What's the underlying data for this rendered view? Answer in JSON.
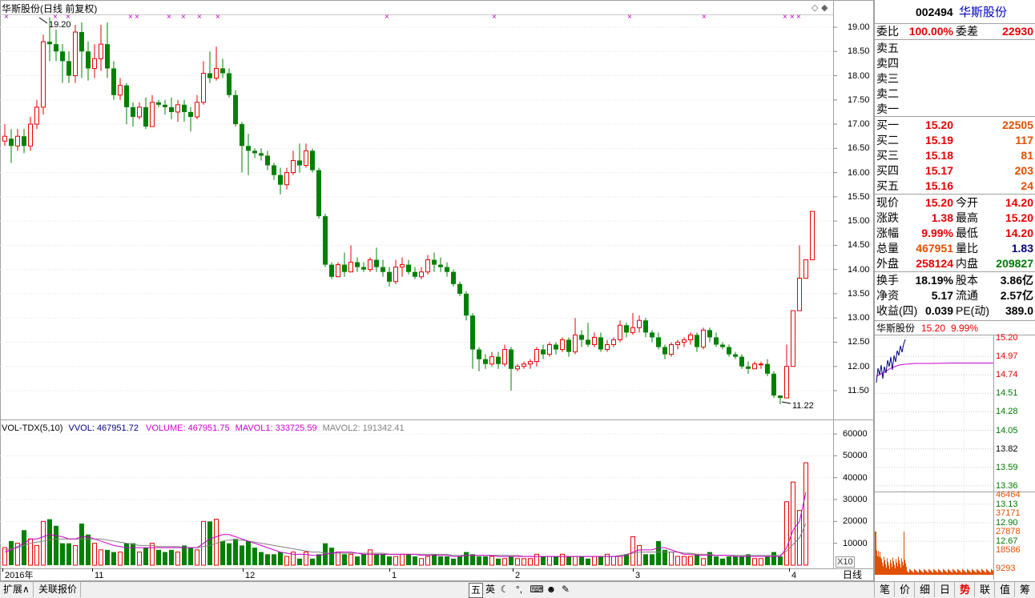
{
  "stock": {
    "code": "002494",
    "name": "华斯股份"
  },
  "chart_title": "华斯股份(日线 前复权)",
  "chart_type_label": "日线",
  "price_axis": [
    "19.00",
    "18.50",
    "18.00",
    "17.50",
    "17.00",
    "16.50",
    "16.00",
    "15.50",
    "15.00",
    "14.50",
    "14.00",
    "13.50",
    "13.00",
    "12.50",
    "12.00",
    "11.50"
  ],
  "volume_axis": [
    "60000",
    "50000",
    "40000",
    "30000",
    "20000",
    "10000"
  ],
  "volume_unit": "X10",
  "date_labels": [
    "2016年",
    "11",
    "12",
    "1",
    "2",
    "3",
    "4"
  ],
  "max_marker": "19.20",
  "min_marker": "11.22",
  "indicator": {
    "name": "VOL-TDX(5,10)",
    "vvol": "VVOL: 467951.72",
    "volume": "VOLUME: 467951.75",
    "mavol1": "MAVOL1: 333725.59",
    "mavol2": "MAVOL2: 191342.41"
  },
  "orderbook": {
    "weibi_label": "委比",
    "weibi_value": "100.00%",
    "weicha_label": "委差",
    "weicha_value": "22930",
    "sells": [
      {
        "label": "卖五"
      },
      {
        "label": "卖四"
      },
      {
        "label": "卖三"
      },
      {
        "label": "卖二"
      },
      {
        "label": "卖一"
      }
    ],
    "buys": [
      {
        "label": "买一",
        "price": "15.20",
        "vol": "22505"
      },
      {
        "label": "买二",
        "price": "15.19",
        "vol": "117"
      },
      {
        "label": "买三",
        "price": "15.18",
        "vol": "81"
      },
      {
        "label": "买四",
        "price": "15.17",
        "vol": "203"
      },
      {
        "label": "买五",
        "price": "15.16",
        "vol": "24"
      }
    ]
  },
  "quote": [
    {
      "l1": "现价",
      "v1": "15.20",
      "l2": "今开",
      "v2": "14.20"
    },
    {
      "l1": "涨跌",
      "v1": "1.38",
      "l2": "最高",
      "v2": "15.20"
    },
    {
      "l1": "涨幅",
      "v1": "9.99%",
      "l2": "最低",
      "v2": "14.20"
    },
    {
      "l1": "总量",
      "v1": "467951",
      "l2": "量比",
      "v2": "1.83"
    },
    {
      "l1": "外盘",
      "v1": "258124",
      "l2": "内盘",
      "v2": "209827"
    }
  ],
  "fundamentals": [
    {
      "l1": "换手",
      "v1": "18.19%",
      "l2": "股本",
      "v2": "3.86亿"
    },
    {
      "l1": "净资",
      "v1": "5.17",
      "l2": "流通",
      "v2": "2.57亿"
    },
    {
      "l1": "收益(四)",
      "v1": "0.039",
      "l2": "PE(动)",
      "v2": "389.0"
    }
  ],
  "mini_chart": {
    "name": "华斯股份",
    "price": "15.20",
    "pct": "9.99%",
    "price_axis": [
      "15.20",
      "14.97",
      "14.74",
      "14.51",
      "14.28",
      "14.05",
      "13.82",
      "13.59",
      "13.36",
      "13.13",
      "12.90",
      "12.67"
    ],
    "vol_axis": [
      "46464",
      "37171",
      "27878",
      "18586",
      "9293"
    ]
  },
  "bottom_buttons": [
    "扩展∧",
    "关联报价"
  ],
  "ime_items": [
    "五",
    "英"
  ],
  "right_tabs": [
    "笔",
    "价",
    "细",
    "日",
    "势",
    "联",
    "值",
    "筹"
  ],
  "active_right_tab": "势",
  "colors": {
    "up": "#e60000",
    "down": "#008000",
    "grid": "#e0e0e0",
    "axis_text": "#000000",
    "ma1": "#cc00cc",
    "ma2": "#808080"
  },
  "chart_data": {
    "type": "candlestick",
    "title": "华斯股份(日线 前复权)",
    "price_ylim": [
      11.0,
      19.3
    ],
    "candles": [
      [
        16.65,
        16.75,
        16.55,
        17.0
      ],
      [
        16.7,
        16.55,
        16.2,
        16.9
      ],
      [
        16.55,
        16.75,
        16.45,
        16.9
      ],
      [
        16.75,
        16.55,
        16.4,
        16.9
      ],
      [
        16.55,
        17.0,
        16.45,
        17.15
      ],
      [
        17.0,
        17.35,
        16.9,
        17.5
      ],
      [
        17.35,
        18.7,
        17.2,
        18.85
      ],
      [
        18.7,
        18.65,
        18.3,
        19.2
      ],
      [
        18.65,
        18.5,
        18.3,
        18.95
      ],
      [
        18.5,
        18.3,
        17.85,
        18.65
      ],
      [
        18.3,
        18.0,
        17.85,
        18.5
      ],
      [
        18.0,
        18.9,
        17.85,
        19.05
      ],
      [
        18.9,
        18.5,
        17.95,
        19.1
      ],
      [
        18.5,
        18.15,
        17.9,
        18.7
      ],
      [
        18.15,
        18.35,
        17.95,
        18.65
      ],
      [
        18.35,
        18.65,
        18.1,
        19.05
      ],
      [
        18.65,
        18.15,
        17.95,
        19.1
      ],
      [
        18.15,
        17.6,
        17.5,
        18.3
      ],
      [
        17.6,
        17.8,
        17.5,
        17.95
      ],
      [
        17.8,
        17.35,
        17.0,
        17.85
      ],
      [
        17.35,
        17.15,
        16.95,
        17.45
      ],
      [
        17.15,
        17.35,
        17.1,
        17.45
      ],
      [
        17.35,
        16.95,
        16.9,
        17.55
      ],
      [
        16.95,
        17.45,
        16.95,
        17.6
      ],
      [
        17.45,
        17.4,
        17.35,
        17.5
      ],
      [
        17.4,
        17.35,
        17.2,
        17.5
      ],
      [
        17.35,
        17.25,
        17.1,
        17.55
      ],
      [
        17.25,
        17.4,
        17.05,
        17.5
      ],
      [
        17.4,
        17.25,
        17.05,
        17.5
      ],
      [
        17.25,
        17.15,
        16.85,
        17.35
      ],
      [
        17.15,
        17.45,
        17.1,
        17.6
      ],
      [
        17.45,
        18.05,
        17.4,
        18.3
      ],
      [
        18.05,
        17.95,
        17.85,
        18.5
      ],
      [
        17.95,
        18.15,
        17.9,
        18.6
      ],
      [
        18.15,
        18.05,
        17.95,
        18.35
      ],
      [
        18.05,
        17.6,
        17.55,
        18.15
      ],
      [
        17.6,
        17.0,
        16.95,
        17.7
      ],
      [
        17.0,
        16.55,
        16.0,
        17.05
      ],
      [
        16.55,
        16.45,
        15.95,
        16.8
      ],
      [
        16.45,
        16.4,
        16.3,
        16.5
      ],
      [
        16.4,
        16.35,
        16.25,
        16.5
      ],
      [
        16.35,
        16.15,
        16.05,
        16.45
      ],
      [
        16.15,
        15.95,
        15.85,
        16.2
      ],
      [
        15.95,
        15.75,
        15.55,
        16.1
      ],
      [
        15.75,
        16.0,
        15.65,
        16.1
      ],
      [
        16.0,
        16.25,
        15.95,
        16.45
      ],
      [
        16.25,
        16.15,
        16.0,
        16.6
      ],
      [
        16.15,
        16.45,
        16.1,
        16.6
      ],
      [
        16.45,
        16.05,
        16.0,
        16.5
      ],
      [
        16.05,
        15.1,
        15.05,
        16.1
      ],
      [
        15.1,
        14.1,
        14.05,
        15.15
      ],
      [
        14.1,
        13.85,
        13.8,
        14.15
      ],
      [
        13.85,
        14.1,
        13.85,
        14.15
      ],
      [
        14.1,
        13.95,
        13.85,
        14.35
      ],
      [
        13.95,
        14.15,
        13.95,
        14.5
      ],
      [
        14.15,
        14.05,
        13.95,
        14.25
      ],
      [
        14.05,
        14.0,
        13.95,
        14.15
      ],
      [
        14.0,
        14.2,
        13.95,
        14.25
      ],
      [
        14.2,
        14.05,
        13.95,
        14.45
      ],
      [
        14.05,
        13.95,
        13.85,
        14.2
      ],
      [
        13.95,
        13.75,
        13.65,
        14.05
      ],
      [
        13.75,
        14.05,
        13.7,
        14.2
      ],
      [
        14.05,
        14.1,
        13.85,
        14.25
      ],
      [
        14.1,
        13.95,
        13.9,
        14.2
      ],
      [
        13.95,
        13.85,
        13.8,
        14.05
      ],
      [
        13.85,
        13.95,
        13.8,
        14.05
      ],
      [
        13.95,
        14.2,
        13.9,
        14.3
      ],
      [
        14.2,
        14.1,
        13.95,
        14.35
      ],
      [
        14.1,
        14.05,
        13.95,
        14.25
      ],
      [
        14.05,
        13.95,
        13.85,
        14.15
      ],
      [
        13.95,
        13.7,
        13.65,
        14.0
      ],
      [
        13.7,
        13.5,
        13.45,
        13.75
      ],
      [
        13.5,
        13.05,
        12.95,
        13.55
      ],
      [
        13.05,
        12.35,
        11.95,
        13.1
      ],
      [
        12.35,
        12.15,
        11.9,
        12.4
      ],
      [
        12.15,
        12.05,
        11.95,
        12.25
      ],
      [
        12.05,
        12.2,
        12.0,
        12.3
      ],
      [
        12.2,
        12.05,
        11.95,
        12.3
      ],
      [
        12.05,
        12.35,
        12.0,
        12.45
      ],
      [
        12.35,
        11.95,
        11.5,
        12.4
      ],
      [
        11.95,
        12.0,
        11.9,
        12.05
      ],
      [
        12.0,
        12.05,
        11.95,
        12.1
      ],
      [
        12.05,
        12.1,
        11.95,
        12.15
      ],
      [
        12.1,
        12.35,
        12.0,
        12.4
      ],
      [
        12.35,
        12.25,
        12.15,
        12.45
      ],
      [
        12.25,
        12.45,
        12.2,
        12.5
      ],
      [
        12.45,
        12.35,
        12.25,
        12.5
      ],
      [
        12.35,
        12.55,
        12.3,
        12.6
      ],
      [
        12.55,
        12.3,
        12.2,
        12.6
      ],
      [
        12.3,
        12.65,
        12.25,
        13.0
      ],
      [
        12.65,
        12.55,
        12.4,
        12.75
      ],
      [
        12.55,
        12.45,
        12.4,
        12.9
      ],
      [
        12.45,
        12.6,
        12.4,
        12.7
      ],
      [
        12.6,
        12.35,
        12.3,
        12.7
      ],
      [
        12.35,
        12.45,
        12.3,
        12.55
      ],
      [
        12.45,
        12.55,
        12.4,
        12.6
      ],
      [
        12.55,
        12.85,
        12.5,
        12.95
      ],
      [
        12.85,
        12.7,
        12.6,
        12.9
      ],
      [
        12.7,
        12.8,
        12.65,
        13.1
      ],
      [
        12.8,
        12.95,
        12.7,
        13.05
      ],
      [
        12.95,
        12.7,
        12.6,
        13.0
      ],
      [
        12.7,
        12.6,
        12.5,
        12.75
      ],
      [
        12.6,
        12.4,
        12.35,
        12.7
      ],
      [
        12.4,
        12.25,
        12.15,
        12.45
      ],
      [
        12.25,
        12.45,
        12.2,
        12.5
      ],
      [
        12.45,
        12.5,
        12.35,
        12.55
      ],
      [
        12.5,
        12.55,
        12.4,
        12.6
      ],
      [
        12.55,
        12.65,
        12.45,
        12.7
      ],
      [
        12.65,
        12.4,
        12.3,
        12.7
      ],
      [
        12.4,
        12.75,
        12.35,
        12.8
      ],
      [
        12.75,
        12.6,
        12.5,
        12.8
      ],
      [
        12.6,
        12.45,
        12.4,
        12.7
      ],
      [
        12.45,
        12.4,
        12.35,
        12.5
      ],
      [
        12.4,
        12.25,
        12.2,
        12.45
      ],
      [
        12.25,
        12.2,
        12.15,
        12.3
      ],
      [
        12.2,
        12.0,
        11.95,
        12.25
      ],
      [
        12.0,
        11.95,
        11.85,
        12.1
      ],
      [
        11.95,
        12.05,
        11.95,
        12.1
      ],
      [
        12.05,
        12.05,
        11.95,
        12.1
      ],
      [
        12.05,
        11.85,
        11.8,
        12.15
      ],
      [
        11.85,
        11.4,
        11.35,
        11.9
      ],
      [
        11.4,
        11.35,
        11.22,
        11.4
      ],
      [
        11.35,
        12.0,
        11.35,
        12.45
      ],
      [
        12.0,
        13.15,
        12.8,
        13.15
      ],
      [
        13.15,
        13.82,
        13.6,
        14.5
      ],
      [
        13.82,
        14.2,
        13.82,
        14.2
      ],
      [
        14.2,
        15.2,
        14.2,
        15.2
      ]
    ],
    "volumes": [
      8000,
      11000,
      10000,
      16000,
      12000,
      9000,
      20000,
      21000,
      18000,
      10000,
      10000,
      9000,
      19000,
      14000,
      10000,
      7000,
      7000,
      6000,
      6000,
      10000,
      10000,
      6000,
      8000,
      10000,
      7000,
      6000,
      7000,
      6000,
      9000,
      8000,
      7000,
      20000,
      20000,
      21000,
      11000,
      10000,
      12000,
      9000,
      11000,
      8000,
      6000,
      5000,
      5000,
      6000,
      4000,
      6000,
      3000,
      6000,
      3000,
      5000,
      10000,
      8000,
      6000,
      5000,
      5000,
      4000,
      5000,
      7000,
      5000,
      5000,
      4000,
      4000,
      5000,
      5000,
      4000,
      3000,
      4000,
      5000,
      4000,
      4000,
      3000,
      4000,
      6000,
      5000,
      4000,
      4000,
      4000,
      3000,
      3000,
      4000,
      3000,
      3000,
      3000,
      5000,
      4000,
      4000,
      4000,
      5000,
      4000,
      4000,
      4000,
      3000,
      4000,
      4000,
      5000,
      4000,
      4000,
      5000,
      13000,
      9000,
      5000,
      5000,
      11000,
      7000,
      6000,
      4000,
      4000,
      4000,
      5000,
      3000,
      6000,
      4000,
      3000,
      4000,
      4000,
      4000,
      5000,
      3000,
      3000,
      4000,
      6000,
      4000,
      29000,
      38000,
      25000,
      46800
    ],
    "mavol1": [
      6000,
      7000,
      8500,
      10000,
      12000,
      12000,
      13000,
      14000,
      13500,
      13000,
      12000,
      12000,
      13000,
      13000,
      12000,
      11000,
      10000,
      9000,
      8500,
      8000,
      8000,
      8000,
      8000,
      8000,
      8000,
      8000,
      8000,
      8000,
      8000,
      8000,
      8000,
      10000,
      12000,
      13000,
      14000,
      14000,
      13000,
      12000,
      11000,
      10000,
      9000,
      8000,
      7000,
      6000,
      5500,
      5000,
      5000,
      5000,
      4500,
      4500,
      5000,
      5500,
      6000,
      6000,
      6000,
      5500,
      5000,
      5000,
      5000,
      5000,
      5000,
      5000,
      5000,
      5000,
      5000,
      4500,
      4500,
      4500,
      4500,
      4500,
      4000,
      4000,
      4500,
      4500,
      4500,
      4500,
      4500,
      4000,
      4000,
      4000,
      4000,
      4000,
      4000,
      4000,
      4000,
      4000,
      4000,
      4000,
      4000,
      4000,
      4000,
      4000,
      4000,
      4000,
      4000,
      4000,
      4000,
      4500,
      6000,
      7000,
      7000,
      7000,
      8000,
      8000,
      7000,
      6000,
      5000,
      5000,
      4500,
      4500,
      4500,
      4500,
      4500,
      4500,
      4000,
      4000,
      4000,
      4000,
      4000,
      4000,
      4000,
      4000,
      8000,
      16000,
      20000,
      33400
    ],
    "mavol2": [
      7000,
      7500,
      8000,
      9000,
      10000,
      10500,
      11000,
      11500,
      12000,
      12000,
      12000,
      12000,
      12000,
      12000,
      12000,
      12000,
      11500,
      11000,
      10500,
      10000,
      9500,
      9000,
      9000,
      9000,
      8500,
      8500,
      8500,
      8500,
      8000,
      8000,
      8000,
      8500,
      9000,
      10000,
      11000,
      11500,
      11500,
      11500,
      11000,
      10500,
      10000,
      9500,
      9000,
      8500,
      8000,
      7500,
      7000,
      6500,
      6000,
      6000,
      5500,
      5500,
      5500,
      5500,
      5500,
      5500,
      5500,
      5500,
      5500,
      5500,
      5000,
      5000,
      5000,
      5000,
      5000,
      5000,
      5000,
      5000,
      5000,
      5000,
      4500,
      4500,
      4500,
      4500,
      4500,
      4500,
      4500,
      4500,
      4500,
      4500,
      4500,
      4000,
      4000,
      4000,
      4000,
      4000,
      4000,
      4000,
      4000,
      4000,
      4000,
      4000,
      4000,
      4000,
      4000,
      4000,
      4500,
      5000,
      5500,
      6000,
      6000,
      6000,
      6000,
      6000,
      6000,
      6000,
      5500,
      5500,
      5000,
      5000,
      5000,
      4500,
      4500,
      4500,
      4500,
      4500,
      4500,
      4500,
      4500,
      4500,
      4500,
      4500,
      6500,
      9500,
      12500,
      19100
    ]
  }
}
